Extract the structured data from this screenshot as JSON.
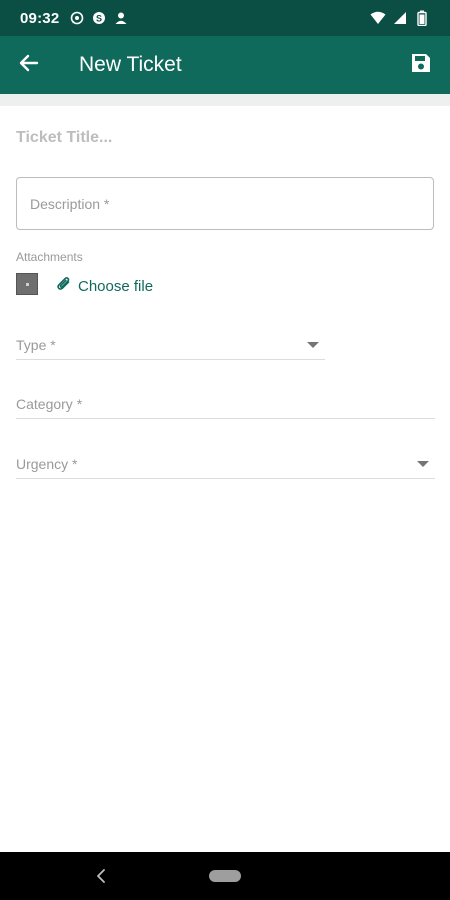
{
  "status_bar": {
    "time": "09:32",
    "left_icons": [
      "whatsapp-icon",
      "skype-icon",
      "account-icon"
    ],
    "right_icons": [
      "wifi-icon",
      "signal-icon",
      "battery-icon"
    ]
  },
  "app_bar": {
    "title": "New Ticket",
    "back_icon": "arrow-left-icon",
    "save_icon": "save-icon",
    "color": "#0f6a5c",
    "status_color": "#0b4f44"
  },
  "form": {
    "title_placeholder": "Ticket Title...",
    "description_placeholder": "Description *",
    "attachments_label": "Attachments",
    "choose_file_label": "Choose file",
    "type_label": "Type *",
    "category_label": "Category *",
    "urgency_label": "Urgency *"
  },
  "nav_bar": {
    "back_icon": "nav-back-icon",
    "home_icon": "home-pill-icon"
  }
}
